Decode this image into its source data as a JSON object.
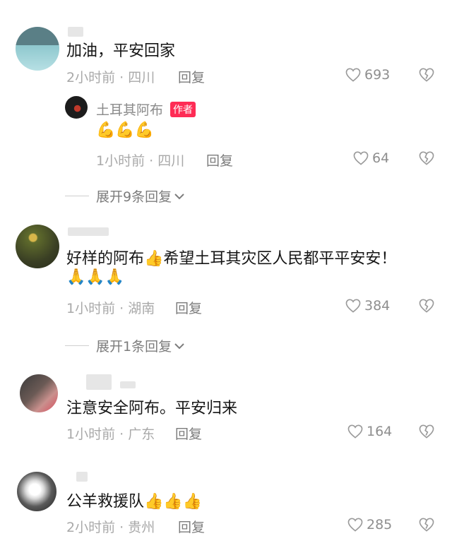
{
  "comments": [
    {
      "text": "加油，平安回家",
      "meta": "2小时前 · 四川",
      "reply_label": "回复",
      "likes": "693",
      "replies": [
        {
          "username": "土耳其阿布",
          "badge": "作者",
          "text": "💪💪💪",
          "meta": "1小时前 · 四川",
          "reply_label": "回复",
          "likes": "64"
        }
      ],
      "expand_label": "展开9条回复"
    },
    {
      "text": "好样的阿布👍希望土耳其灾区人民都平平安安！",
      "emoji_line": "🙏🙏🙏",
      "meta": "1小时前 · 湖南",
      "reply_label": "回复",
      "likes": "384",
      "expand_label": "展开1条回复"
    },
    {
      "text": "注意安全阿布。平安归来",
      "meta": "1小时前 · 广东",
      "reply_label": "回复",
      "likes": "164"
    },
    {
      "text": "公羊救援队👍👍👍",
      "meta": "2小时前 · 贵州",
      "reply_label": "回复",
      "likes": "285"
    }
  ],
  "colors": {
    "accent_badge": "#fe2c55",
    "meta_gray": "#a9a9a9"
  },
  "icons": [
    "heart-icon",
    "dislike-icon",
    "chevron-down-icon"
  ]
}
